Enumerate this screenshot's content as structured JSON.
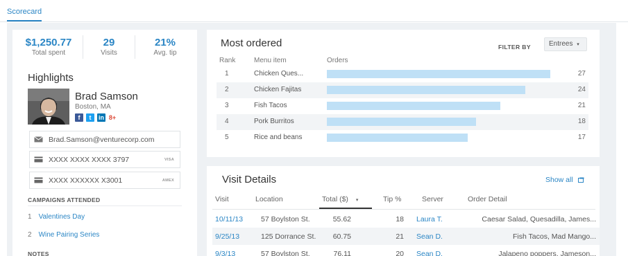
{
  "tabs": {
    "active": "Scorecard"
  },
  "stats": [
    {
      "value": "$1,250.77",
      "label": "Total spent"
    },
    {
      "value": "29",
      "label": "Visits"
    },
    {
      "value": "21%",
      "label": "Avg. tip"
    }
  ],
  "highlights": {
    "title": "Highlights",
    "name": "Brad Samson",
    "location": "Boston, MA",
    "socials": [
      {
        "icon": "facebook-icon",
        "glyph": "f",
        "color": "#3b5998"
      },
      {
        "icon": "twitter-icon",
        "glyph": "t",
        "color": "#1da1f2"
      },
      {
        "icon": "linkedin-icon",
        "glyph": "in",
        "color": "#0077b5"
      },
      {
        "icon": "googleplus-icon",
        "glyph": "8+",
        "color": "#dd4b39"
      }
    ],
    "email": "Brad.Samson@venturecorp.com",
    "cards": [
      {
        "number": "XXXX XXXX XXXX 3797",
        "brand": "VISA"
      },
      {
        "number": "XXXX XXXXXX X3001",
        "brand": "AMEX"
      }
    ]
  },
  "campaigns": {
    "heading": "CAMPAIGNS ATTENDED",
    "items": [
      {
        "index": "1",
        "label": "Valentines Day"
      },
      {
        "index": "2",
        "label": "Wine Pairing Series"
      }
    ]
  },
  "notes": {
    "heading": "NOTES"
  },
  "most_ordered": {
    "title": "Most ordered",
    "filter_label": "FILTER BY",
    "filter_value": "Entrees",
    "columns": [
      "Rank",
      "Menu item",
      "Orders"
    ],
    "rows": [
      {
        "rank": "1",
        "item": "Chicken Ques...",
        "orders": 27
      },
      {
        "rank": "2",
        "item": "Chicken Fajitas",
        "orders": 24
      },
      {
        "rank": "3",
        "item": "Fish Tacos",
        "orders": 21
      },
      {
        "rank": "4",
        "item": "Pork Burritos",
        "orders": 18
      },
      {
        "rank": "5",
        "item": "Rice and beans",
        "orders": 17
      }
    ]
  },
  "visit_details": {
    "title": "Visit Details",
    "show_all": "Show all",
    "columns": [
      "Visit",
      "Location",
      "Total ($)",
      "Tip %",
      "Server",
      "Order Detail"
    ],
    "rows": [
      {
        "visit": "10/11/13",
        "location": "57 Boylston St.",
        "total": "55.62",
        "tip": "18",
        "server": "Laura T.",
        "detail": "Caesar Salad, Quesadilla, James..."
      },
      {
        "visit": "9/25/13",
        "location": "125 Dorrance St.",
        "total": "60.75",
        "tip": "21",
        "server": "Sean D.",
        "detail": "Fish Tacos, Mad Mango..."
      },
      {
        "visit": "9/3/13",
        "location": "57 Boylston St.",
        "total": "76.11",
        "tip": "20",
        "server": "Sean D.",
        "detail": "Jalapeno poppers, Jameson..."
      }
    ]
  }
}
